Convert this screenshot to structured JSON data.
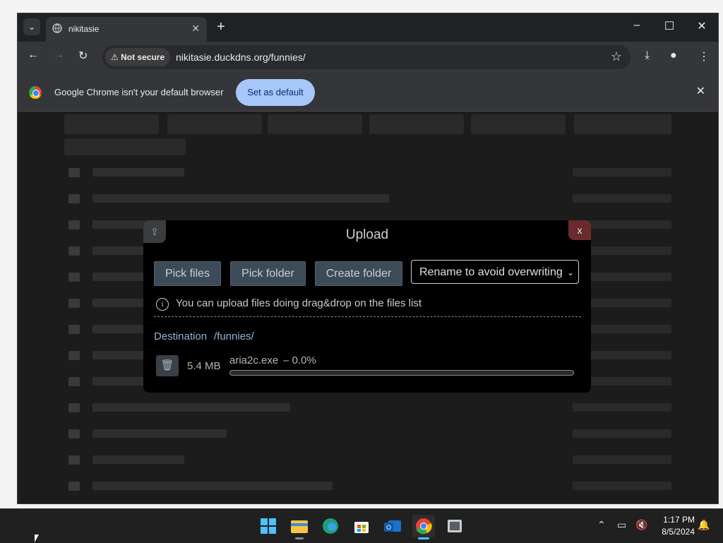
{
  "browser": {
    "tab_title": "nikitasie",
    "security_chip": "Not secure",
    "url": "nikitasie.duckdns.org/funnies/",
    "infobar_text": "Google Chrome isn't your default browser",
    "infobar_button": "Set as default"
  },
  "modal": {
    "title": "Upload",
    "close_label": "x",
    "pick_files": "Pick files",
    "pick_folder": "Pick folder",
    "create_folder": "Create folder",
    "conflict_option": "Rename to avoid overwriting",
    "hint": "You can upload files doing drag&drop on the files list",
    "destination_label": "Destination",
    "destination_path": "/funnies/",
    "upload_item": {
      "size": "5.4 MB",
      "name": "aria2c.exe",
      "progress_text": "– 0.0%",
      "progress_fraction": 0.0
    }
  },
  "taskbar": {
    "time": "1:17 PM",
    "date": "8/5/2024"
  },
  "colors": {
    "accent_button": "#a8c7fa",
    "modal_close": "#6b2a2e",
    "destination_text": "#8fb3d8"
  }
}
